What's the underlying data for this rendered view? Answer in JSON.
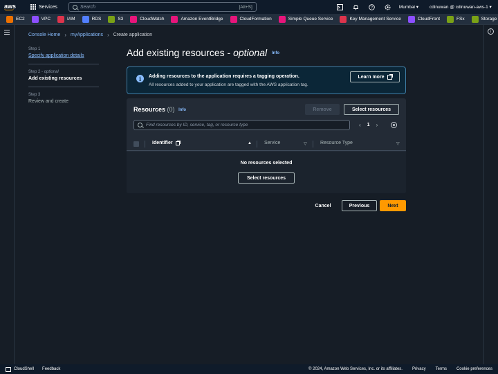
{
  "topnav": {
    "logo": "aws",
    "services_label": "Services",
    "search_placeholder": "Search",
    "search_shortcut": "[Alt+S]",
    "icons": [
      "cloudshell-icon",
      "bell-icon",
      "help-icon",
      "gear-icon"
    ],
    "region": "Mumbai",
    "account": "cdinuwan @ cdinuwan-aws-1"
  },
  "favorites": [
    {
      "label": "EC2",
      "color": "#ed7100"
    },
    {
      "label": "VPC",
      "color": "#8c4fff"
    },
    {
      "label": "IAM",
      "color": "#dd344c"
    },
    {
      "label": "RDS",
      "color": "#527fff"
    },
    {
      "label": "S3",
      "color": "#7aa116"
    },
    {
      "label": "CloudWatch",
      "color": "#e7157b"
    },
    {
      "label": "Amazon EventBridge",
      "color": "#e7157b"
    },
    {
      "label": "CloudFormation",
      "color": "#e7157b"
    },
    {
      "label": "Simple Queue Service",
      "color": "#e7157b"
    },
    {
      "label": "Key Management Service",
      "color": "#dd344c"
    },
    {
      "label": "CloudFront",
      "color": "#8c4fff"
    },
    {
      "label": "FSx",
      "color": "#7aa116"
    },
    {
      "label": "Storage Gatewa",
      "color": "#7aa116"
    }
  ],
  "breadcrumb": {
    "console_home": "Console Home",
    "my_applications": "myApplications",
    "current": "Create application"
  },
  "steps": [
    {
      "num": "Step 1",
      "optional": "",
      "label": "Specify application details"
    },
    {
      "num": "Step 2 - ",
      "optional": "optional",
      "label": "Add existing resources"
    },
    {
      "num": "Step 3",
      "optional": "",
      "label": "Review and create"
    }
  ],
  "page": {
    "title": "Add existing resources - ",
    "title_optional": "optional",
    "info": "Info"
  },
  "alert": {
    "title": "Adding resources to the application requires a tagging operation.",
    "body": "All resources added to your application are tagged with the AWS application tag.",
    "learn_more": "Learn more"
  },
  "resources": {
    "title": "Resources",
    "count": "(0)",
    "info": "Info",
    "remove_label": "Remove",
    "select_label": "Select resources",
    "filter_placeholder": "Find resources by ID, service, tag, or resource type",
    "page": "1",
    "columns": {
      "identifier": "Identifier",
      "service": "Service",
      "resource_type": "Resource Type"
    },
    "empty_text": "No resources selected",
    "empty_button": "Select resources"
  },
  "footer_buttons": {
    "cancel": "Cancel",
    "previous": "Previous",
    "next": "Next"
  },
  "bottombar": {
    "cloudshell": "CloudShell",
    "feedback": "Feedback",
    "copyright": "© 2024, Amazon Web Services, Inc. or its affiliates.",
    "privacy": "Privacy",
    "terms": "Terms",
    "cookies": "Cookie preferences"
  }
}
